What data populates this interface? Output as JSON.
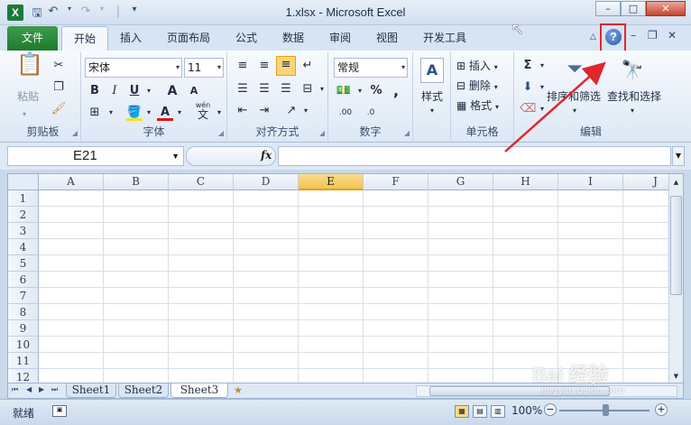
{
  "window": {
    "title": "1.xlsx - Microsoft Excel",
    "app_icon": "X",
    "qat": {
      "save_icon": "save-icon",
      "undo_icon": "undo-icon",
      "redo_icon": "redo-icon"
    }
  },
  "tabs": {
    "file": "文件",
    "items": [
      "开始",
      "插入",
      "页面布局",
      "公式",
      "数据",
      "审阅",
      "视图",
      "开发工具"
    ],
    "active": "开始"
  },
  "ribbon": {
    "clipboard": {
      "paste": "粘贴",
      "label": "剪贴板"
    },
    "font": {
      "name": "宋体",
      "size": "11",
      "bold": "B",
      "italic": "I",
      "underline": "U",
      "grow": "A",
      "shrink": "A",
      "font_color": "A",
      "phonetic": "wén",
      "phonetic_char": "文",
      "label": "字体"
    },
    "alignment": {
      "label": "对齐方式"
    },
    "number": {
      "format": "常规",
      "percent": "%",
      "comma": ",",
      "inc_decimal": ".00",
      "dec_decimal": ".0",
      "label": "数字"
    },
    "styles": {
      "label": "样式"
    },
    "cells": {
      "insert": "插入",
      "delete": "删除",
      "format": "格式",
      "label": "单元格"
    },
    "editing": {
      "sum": "Σ",
      "sort_filter": "排序和筛选",
      "find_select": "查找和选择",
      "label": "编辑"
    }
  },
  "formula_bar": {
    "name_box": "E21",
    "fx": "fx",
    "formula": ""
  },
  "grid": {
    "columns": [
      "A",
      "B",
      "C",
      "D",
      "E",
      "F",
      "G",
      "H",
      "I",
      "J"
    ],
    "selected_column": "E",
    "rows": [
      "1",
      "2",
      "3",
      "4",
      "5",
      "6",
      "7",
      "8",
      "9",
      "10",
      "11",
      "12"
    ]
  },
  "sheets": {
    "tabs": [
      "Sheet1",
      "Sheet2",
      "Sheet3"
    ],
    "active": "Sheet3"
  },
  "status": {
    "mode": "就绪",
    "zoom": "100%",
    "zoom_minus": "−",
    "zoom_plus": "+"
  },
  "watermark": {
    "text": "Bai 经验",
    "sub": "jingyan.baidu.com"
  },
  "colors": {
    "file_tab": "#1f7a2f",
    "highlight": "#e1262c",
    "arrow": "#e1262c",
    "selected_col": "#f2c24f"
  }
}
